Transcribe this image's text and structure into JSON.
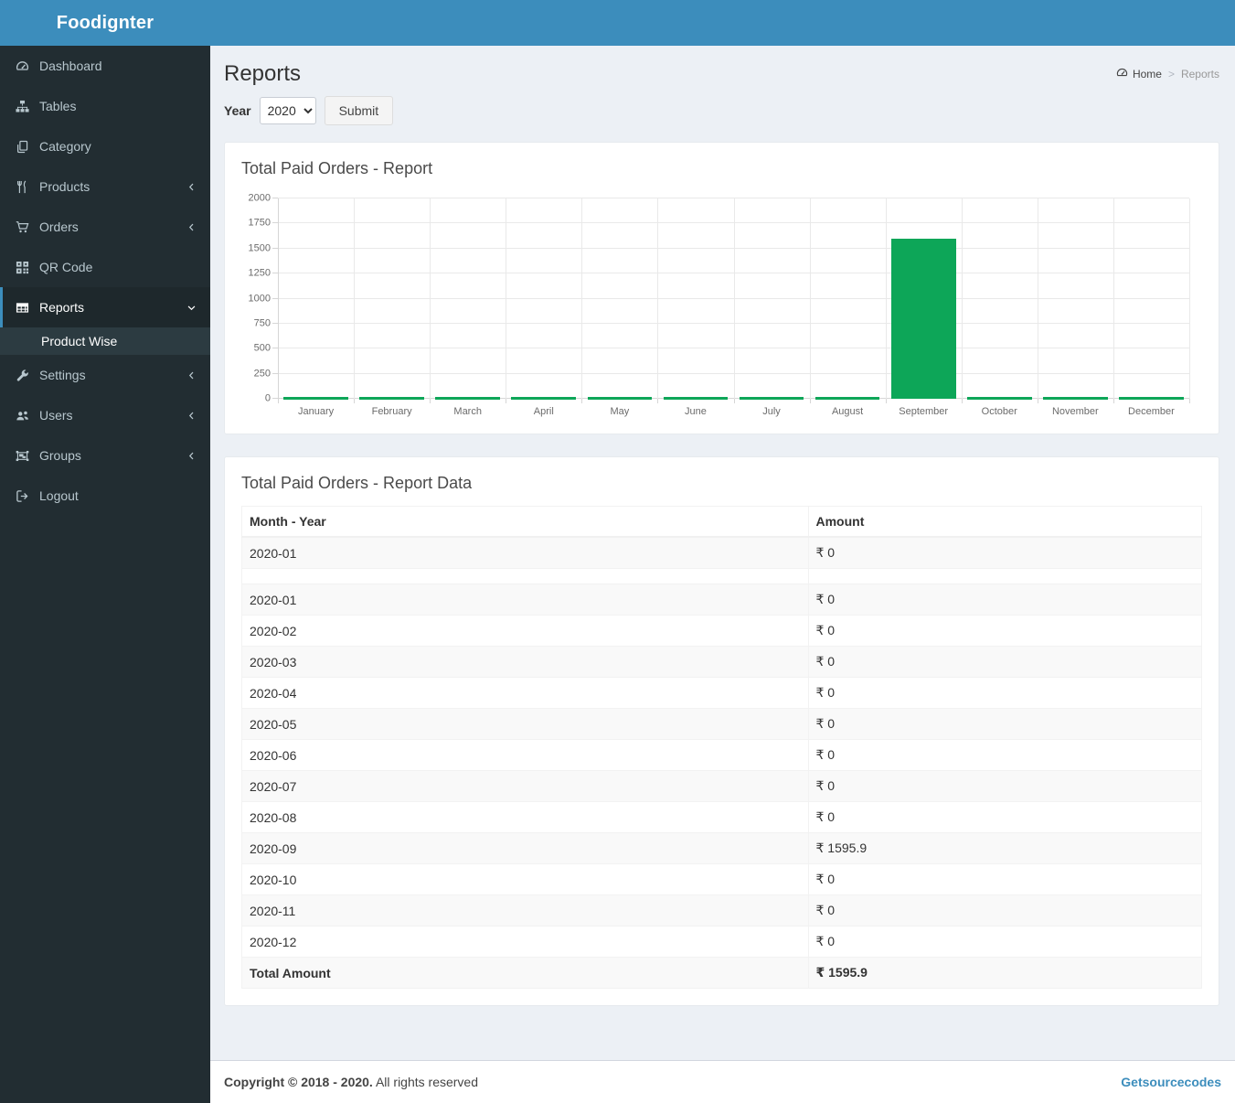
{
  "app": {
    "brand": "Foodignter"
  },
  "sidebar": {
    "items": [
      {
        "label": "Dashboard",
        "icon": "dashboard-icon"
      },
      {
        "label": "Tables",
        "icon": "sitemap-icon"
      },
      {
        "label": "Category",
        "icon": "copy-icon"
      },
      {
        "label": "Products",
        "icon": "cutlery-icon",
        "chevron": "left"
      },
      {
        "label": "Orders",
        "icon": "cart-icon",
        "chevron": "left"
      },
      {
        "label": "QR Code",
        "icon": "qrcode-icon"
      },
      {
        "label": "Reports",
        "icon": "table-icon",
        "chevron": "down",
        "active": true,
        "subitems": [
          {
            "label": "Product Wise",
            "active": true
          }
        ]
      },
      {
        "label": "Settings",
        "icon": "wrench-icon",
        "chevron": "left"
      },
      {
        "label": "Users",
        "icon": "users-icon",
        "chevron": "left"
      },
      {
        "label": "Groups",
        "icon": "object-group-icon",
        "chevron": "left"
      },
      {
        "label": "Logout",
        "icon": "sign-out-icon"
      }
    ]
  },
  "page": {
    "title": "Reports",
    "breadcrumb": {
      "home": "Home",
      "separator": ">",
      "current": "Reports"
    }
  },
  "filter": {
    "year_label": "Year",
    "year_value": "2020",
    "year_options": [
      "2020"
    ],
    "submit_label": "Submit"
  },
  "chart_card": {
    "title": "Total Paid Orders - Report"
  },
  "chart_data": {
    "type": "bar",
    "title": "Total Paid Orders - Report",
    "categories": [
      "January",
      "February",
      "March",
      "April",
      "May",
      "June",
      "July",
      "August",
      "September",
      "October",
      "November",
      "December"
    ],
    "values": [
      0,
      0,
      0,
      0,
      0,
      0,
      0,
      0,
      1595.9,
      0,
      0,
      0
    ],
    "xlabel": "",
    "ylabel": "",
    "ylim": [
      0,
      2000
    ],
    "ytick_step": 250,
    "grid": true,
    "legend": "none",
    "bar_color": "#0da658"
  },
  "table_card": {
    "title": "Total Paid Orders - Report Data",
    "columns": [
      "Month - Year",
      "Amount"
    ],
    "rows": [
      {
        "month": "2020-01",
        "amount": "₹ 0"
      },
      {
        "month": "",
        "amount": "",
        "empty": true
      },
      {
        "month": "2020-01",
        "amount": "₹ 0"
      },
      {
        "month": "2020-02",
        "amount": "₹ 0"
      },
      {
        "month": "2020-03",
        "amount": "₹ 0"
      },
      {
        "month": "2020-04",
        "amount": "₹ 0"
      },
      {
        "month": "2020-05",
        "amount": "₹ 0"
      },
      {
        "month": "2020-06",
        "amount": "₹ 0"
      },
      {
        "month": "2020-07",
        "amount": "₹ 0"
      },
      {
        "month": "2020-08",
        "amount": "₹ 0"
      },
      {
        "month": "2020-09",
        "amount": "₹ 1595.9"
      },
      {
        "month": "2020-10",
        "amount": "₹ 0"
      },
      {
        "month": "2020-11",
        "amount": "₹ 0"
      },
      {
        "month": "2020-12",
        "amount": "₹ 0"
      }
    ],
    "total": {
      "label": "Total Amount",
      "amount": "₹ 1595.9"
    }
  },
  "footer": {
    "copyright_bold": "Copyright © 2018 - 2020.",
    "copyright_rest": "All rights reserved",
    "credit": "Getsourcecodes"
  },
  "colors": {
    "accent_blue": "#3c8dbc",
    "sidebar_bg": "#222d32",
    "active_item_bg": "#1e282c",
    "submenu_bg": "#2c3b41",
    "content_bg": "#ecf0f5",
    "bar_green": "#0da658",
    "link_blue": "#3c8dbc"
  }
}
